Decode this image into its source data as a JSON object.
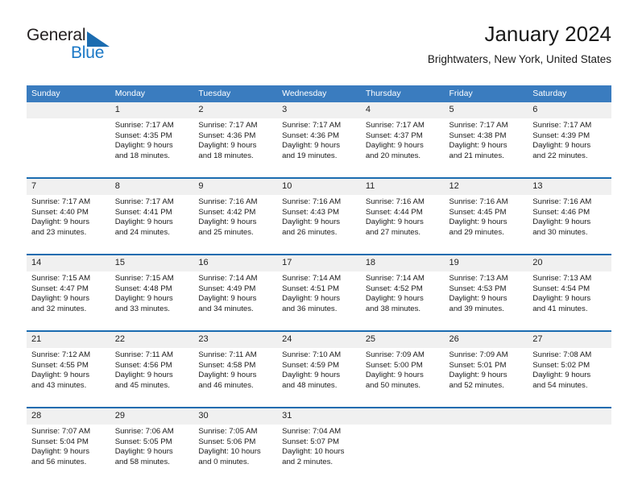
{
  "brand": {
    "name_part1": "General",
    "name_part2": "Blue",
    "triangle_icon": "triangle-icon",
    "colors": {
      "dark_text": "#231f20",
      "blue_text": "#1b78c6",
      "triangle": "#1b6cb0"
    }
  },
  "header": {
    "title": "January 2024",
    "subtitle": "Brightwaters, New York, United States"
  },
  "theme": {
    "header_bg": "#3a7cbf",
    "header_text": "#ffffff",
    "daynum_bg": "#f0f0f0",
    "row_rule": "#1b6cb0",
    "cell_bg": "#ffffff"
  },
  "calendar": {
    "weekday_headers": [
      "Sunday",
      "Monday",
      "Tuesday",
      "Wednesday",
      "Thursday",
      "Friday",
      "Saturday"
    ],
    "weeks": [
      {
        "days": [
          {
            "date": "",
            "sunrise": "",
            "sunset": "",
            "daylight_line1": "",
            "daylight_line2": ""
          },
          {
            "date": "1",
            "sunrise": "Sunrise: 7:17 AM",
            "sunset": "Sunset: 4:35 PM",
            "daylight_line1": "Daylight: 9 hours",
            "daylight_line2": "and 18 minutes."
          },
          {
            "date": "2",
            "sunrise": "Sunrise: 7:17 AM",
            "sunset": "Sunset: 4:36 PM",
            "daylight_line1": "Daylight: 9 hours",
            "daylight_line2": "and 18 minutes."
          },
          {
            "date": "3",
            "sunrise": "Sunrise: 7:17 AM",
            "sunset": "Sunset: 4:36 PM",
            "daylight_line1": "Daylight: 9 hours",
            "daylight_line2": "and 19 minutes."
          },
          {
            "date": "4",
            "sunrise": "Sunrise: 7:17 AM",
            "sunset": "Sunset: 4:37 PM",
            "daylight_line1": "Daylight: 9 hours",
            "daylight_line2": "and 20 minutes."
          },
          {
            "date": "5",
            "sunrise": "Sunrise: 7:17 AM",
            "sunset": "Sunset: 4:38 PM",
            "daylight_line1": "Daylight: 9 hours",
            "daylight_line2": "and 21 minutes."
          },
          {
            "date": "6",
            "sunrise": "Sunrise: 7:17 AM",
            "sunset": "Sunset: 4:39 PM",
            "daylight_line1": "Daylight: 9 hours",
            "daylight_line2": "and 22 minutes."
          }
        ]
      },
      {
        "days": [
          {
            "date": "7",
            "sunrise": "Sunrise: 7:17 AM",
            "sunset": "Sunset: 4:40 PM",
            "daylight_line1": "Daylight: 9 hours",
            "daylight_line2": "and 23 minutes."
          },
          {
            "date": "8",
            "sunrise": "Sunrise: 7:17 AM",
            "sunset": "Sunset: 4:41 PM",
            "daylight_line1": "Daylight: 9 hours",
            "daylight_line2": "and 24 minutes."
          },
          {
            "date": "9",
            "sunrise": "Sunrise: 7:16 AM",
            "sunset": "Sunset: 4:42 PM",
            "daylight_line1": "Daylight: 9 hours",
            "daylight_line2": "and 25 minutes."
          },
          {
            "date": "10",
            "sunrise": "Sunrise: 7:16 AM",
            "sunset": "Sunset: 4:43 PM",
            "daylight_line1": "Daylight: 9 hours",
            "daylight_line2": "and 26 minutes."
          },
          {
            "date": "11",
            "sunrise": "Sunrise: 7:16 AM",
            "sunset": "Sunset: 4:44 PM",
            "daylight_line1": "Daylight: 9 hours",
            "daylight_line2": "and 27 minutes."
          },
          {
            "date": "12",
            "sunrise": "Sunrise: 7:16 AM",
            "sunset": "Sunset: 4:45 PM",
            "daylight_line1": "Daylight: 9 hours",
            "daylight_line2": "and 29 minutes."
          },
          {
            "date": "13",
            "sunrise": "Sunrise: 7:16 AM",
            "sunset": "Sunset: 4:46 PM",
            "daylight_line1": "Daylight: 9 hours",
            "daylight_line2": "and 30 minutes."
          }
        ]
      },
      {
        "days": [
          {
            "date": "14",
            "sunrise": "Sunrise: 7:15 AM",
            "sunset": "Sunset: 4:47 PM",
            "daylight_line1": "Daylight: 9 hours",
            "daylight_line2": "and 32 minutes."
          },
          {
            "date": "15",
            "sunrise": "Sunrise: 7:15 AM",
            "sunset": "Sunset: 4:48 PM",
            "daylight_line1": "Daylight: 9 hours",
            "daylight_line2": "and 33 minutes."
          },
          {
            "date": "16",
            "sunrise": "Sunrise: 7:14 AM",
            "sunset": "Sunset: 4:49 PM",
            "daylight_line1": "Daylight: 9 hours",
            "daylight_line2": "and 34 minutes."
          },
          {
            "date": "17",
            "sunrise": "Sunrise: 7:14 AM",
            "sunset": "Sunset: 4:51 PM",
            "daylight_line1": "Daylight: 9 hours",
            "daylight_line2": "and 36 minutes."
          },
          {
            "date": "18",
            "sunrise": "Sunrise: 7:14 AM",
            "sunset": "Sunset: 4:52 PM",
            "daylight_line1": "Daylight: 9 hours",
            "daylight_line2": "and 38 minutes."
          },
          {
            "date": "19",
            "sunrise": "Sunrise: 7:13 AM",
            "sunset": "Sunset: 4:53 PM",
            "daylight_line1": "Daylight: 9 hours",
            "daylight_line2": "and 39 minutes."
          },
          {
            "date": "20",
            "sunrise": "Sunrise: 7:13 AM",
            "sunset": "Sunset: 4:54 PM",
            "daylight_line1": "Daylight: 9 hours",
            "daylight_line2": "and 41 minutes."
          }
        ]
      },
      {
        "days": [
          {
            "date": "21",
            "sunrise": "Sunrise: 7:12 AM",
            "sunset": "Sunset: 4:55 PM",
            "daylight_line1": "Daylight: 9 hours",
            "daylight_line2": "and 43 minutes."
          },
          {
            "date": "22",
            "sunrise": "Sunrise: 7:11 AM",
            "sunset": "Sunset: 4:56 PM",
            "daylight_line1": "Daylight: 9 hours",
            "daylight_line2": "and 45 minutes."
          },
          {
            "date": "23",
            "sunrise": "Sunrise: 7:11 AM",
            "sunset": "Sunset: 4:58 PM",
            "daylight_line1": "Daylight: 9 hours",
            "daylight_line2": "and 46 minutes."
          },
          {
            "date": "24",
            "sunrise": "Sunrise: 7:10 AM",
            "sunset": "Sunset: 4:59 PM",
            "daylight_line1": "Daylight: 9 hours",
            "daylight_line2": "and 48 minutes."
          },
          {
            "date": "25",
            "sunrise": "Sunrise: 7:09 AM",
            "sunset": "Sunset: 5:00 PM",
            "daylight_line1": "Daylight: 9 hours",
            "daylight_line2": "and 50 minutes."
          },
          {
            "date": "26",
            "sunrise": "Sunrise: 7:09 AM",
            "sunset": "Sunset: 5:01 PM",
            "daylight_line1": "Daylight: 9 hours",
            "daylight_line2": "and 52 minutes."
          },
          {
            "date": "27",
            "sunrise": "Sunrise: 7:08 AM",
            "sunset": "Sunset: 5:02 PM",
            "daylight_line1": "Daylight: 9 hours",
            "daylight_line2": "and 54 minutes."
          }
        ]
      },
      {
        "days": [
          {
            "date": "28",
            "sunrise": "Sunrise: 7:07 AM",
            "sunset": "Sunset: 5:04 PM",
            "daylight_line1": "Daylight: 9 hours",
            "daylight_line2": "and 56 minutes."
          },
          {
            "date": "29",
            "sunrise": "Sunrise: 7:06 AM",
            "sunset": "Sunset: 5:05 PM",
            "daylight_line1": "Daylight: 9 hours",
            "daylight_line2": "and 58 minutes."
          },
          {
            "date": "30",
            "sunrise": "Sunrise: 7:05 AM",
            "sunset": "Sunset: 5:06 PM",
            "daylight_line1": "Daylight: 10 hours",
            "daylight_line2": "and 0 minutes."
          },
          {
            "date": "31",
            "sunrise": "Sunrise: 7:04 AM",
            "sunset": "Sunset: 5:07 PM",
            "daylight_line1": "Daylight: 10 hours",
            "daylight_line2": "and 2 minutes."
          },
          {
            "date": "",
            "sunrise": "",
            "sunset": "",
            "daylight_line1": "",
            "daylight_line2": ""
          },
          {
            "date": "",
            "sunrise": "",
            "sunset": "",
            "daylight_line1": "",
            "daylight_line2": ""
          },
          {
            "date": "",
            "sunrise": "",
            "sunset": "",
            "daylight_line1": "",
            "daylight_line2": ""
          }
        ]
      }
    ]
  }
}
